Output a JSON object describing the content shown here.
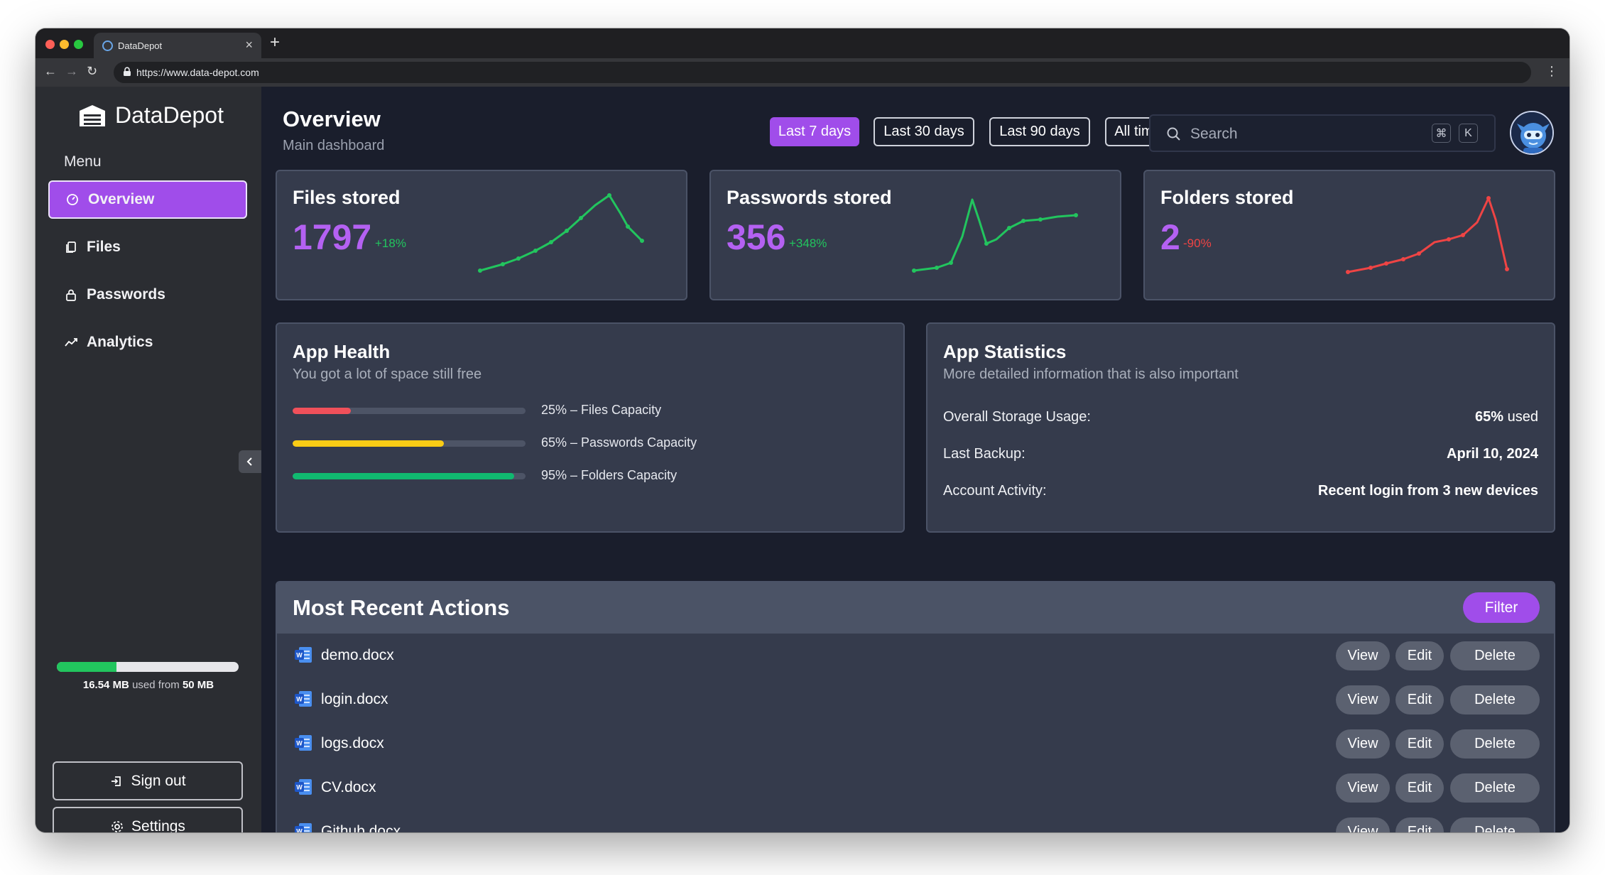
{
  "browser": {
    "tab_title": "DataDepot",
    "url": "https://www.data-depot.com"
  },
  "app": {
    "name": "DataDepot"
  },
  "sidebar": {
    "menu_heading": "Menu",
    "items": [
      {
        "label": "Overview",
        "icon": "dashboard-icon",
        "active": true
      },
      {
        "label": "Files",
        "icon": "files-icon",
        "active": false
      },
      {
        "label": "Passwords",
        "icon": "lock-icon",
        "active": false
      },
      {
        "label": "Analytics",
        "icon": "analytics-icon",
        "active": false
      }
    ],
    "storage": {
      "used": "16.54 MB",
      "used_text": "used from",
      "total": "50 MB",
      "used_fraction": 0.33
    },
    "sign_out_label": "Sign out",
    "settings_label": "Settings"
  },
  "header": {
    "title": "Overview",
    "subtitle": "Main dashboard",
    "ranges": [
      "Last 7 days",
      "Last 30 days",
      "Last 90 days",
      "All time"
    ],
    "active_range": "Last 7 days",
    "search": {
      "placeholder": "Search",
      "shortcut_keys": [
        "⌘",
        "K"
      ]
    }
  },
  "kpis": [
    {
      "title": "Files stored",
      "value": "1797",
      "delta": "+18%",
      "trend": "up",
      "color": "#22c55e"
    },
    {
      "title": "Passwords stored",
      "value": "356",
      "delta": "+348%",
      "trend": "up",
      "color": "#22c55e"
    },
    {
      "title": "Folders stored",
      "value": "2",
      "delta": "-90%",
      "trend": "down",
      "color": "#ef4444"
    }
  ],
  "health": {
    "title": "App Health",
    "subtitle": "You got a lot of space still free",
    "bars": [
      {
        "label": "25% – Files Capacity",
        "percent": 25,
        "color": "#f0505a"
      },
      {
        "label": "65% – Passwords Capacity",
        "percent": 65,
        "color": "#facc15"
      },
      {
        "label": "95% – Folders Capacity",
        "percent": 95,
        "color": "#10b970"
      }
    ]
  },
  "stats": {
    "title": "App Statistics",
    "subtitle": "More detailed information that is also important",
    "rows": [
      {
        "label": "Overall Storage Usage:",
        "value": "65%",
        "unit": "used"
      },
      {
        "label": "Last Backup:",
        "value": "April 10, 2024",
        "unit": ""
      },
      {
        "label": "Account Activity:",
        "value": "Recent login from 3 new devices",
        "unit": ""
      }
    ]
  },
  "recent": {
    "title": "Most Recent Actions",
    "filter_label": "Filter",
    "files": [
      "demo.docx",
      "login.docx",
      "logs.docx",
      "CV.docx",
      "Github.docx"
    ],
    "actions": [
      "View",
      "Edit",
      "Delete"
    ]
  }
}
